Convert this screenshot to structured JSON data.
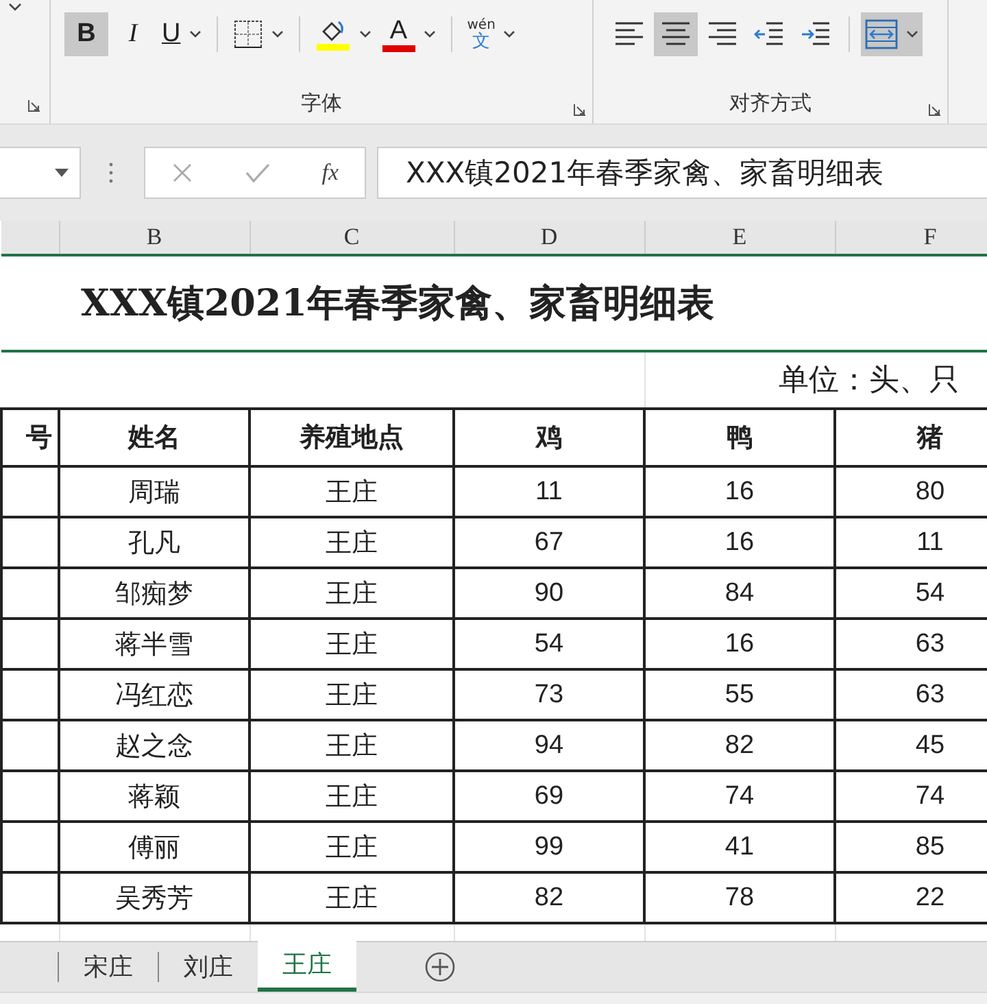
{
  "ribbon": {
    "groups": [
      {
        "label": "字体",
        "tools": [
          {
            "kind": "bold",
            "label": "B",
            "selected": true,
            "dropdown": false
          },
          {
            "kind": "italic",
            "label": "I",
            "selected": false,
            "dropdown": false
          },
          {
            "kind": "underline",
            "label": "U",
            "selected": false,
            "dropdown": true
          },
          {
            "kind": "borders",
            "selected": false,
            "dropdown": true
          },
          {
            "kind": "fill",
            "selected": false,
            "dropdown": true
          },
          {
            "kind": "fontcolor",
            "label": "A",
            "selected": false,
            "dropdown": true
          },
          {
            "kind": "phonetic",
            "label": "wén",
            "sublabel": "文",
            "selected": false,
            "dropdown": true
          }
        ]
      },
      {
        "label": "对齐方式",
        "tools": [
          {
            "kind": "align-left",
            "selected": false,
            "dropdown": false
          },
          {
            "kind": "align-center",
            "selected": true,
            "dropdown": false
          },
          {
            "kind": "align-right",
            "selected": false,
            "dropdown": false
          },
          {
            "kind": "indent-decrease",
            "selected": false,
            "dropdown": false
          },
          {
            "kind": "indent-increase",
            "selected": false,
            "dropdown": false
          },
          {
            "kind": "merge",
            "selected": true,
            "dropdown": true
          }
        ]
      }
    ]
  },
  "formula_bar": {
    "function_label": "fx",
    "content": "XXX镇2021年春季家禽、家畜明细表"
  },
  "sheet": {
    "column_headers": [
      "B",
      "C",
      "D",
      "E",
      "F"
    ],
    "title": "XXX镇2021年春季家禽、家畜明细表",
    "unit": "单位：头、只",
    "headers": [
      "号",
      "姓名",
      "养殖地点",
      "鸡",
      "鸭",
      "猪"
    ],
    "rows": [
      [
        "周瑞",
        "王庄",
        "11",
        "16",
        "80"
      ],
      [
        "孔凡",
        "王庄",
        "67",
        "16",
        "11"
      ],
      [
        "邹痴梦",
        "王庄",
        "90",
        "84",
        "54"
      ],
      [
        "蒋半雪",
        "王庄",
        "54",
        "16",
        "63"
      ],
      [
        "冯红恋",
        "王庄",
        "73",
        "55",
        "63"
      ],
      [
        "赵之念",
        "王庄",
        "94",
        "82",
        "45"
      ],
      [
        "蒋颖",
        "王庄",
        "69",
        "74",
        "74"
      ],
      [
        "傅丽",
        "王庄",
        "99",
        "41",
        "85"
      ],
      [
        "吴秀芳",
        "王庄",
        "82",
        "78",
        "22"
      ]
    ]
  },
  "sheet_tabs": [
    {
      "label": "宋庄",
      "selected": false
    },
    {
      "label": "刘庄",
      "selected": false
    },
    {
      "label": "王庄",
      "selected": true
    }
  ]
}
